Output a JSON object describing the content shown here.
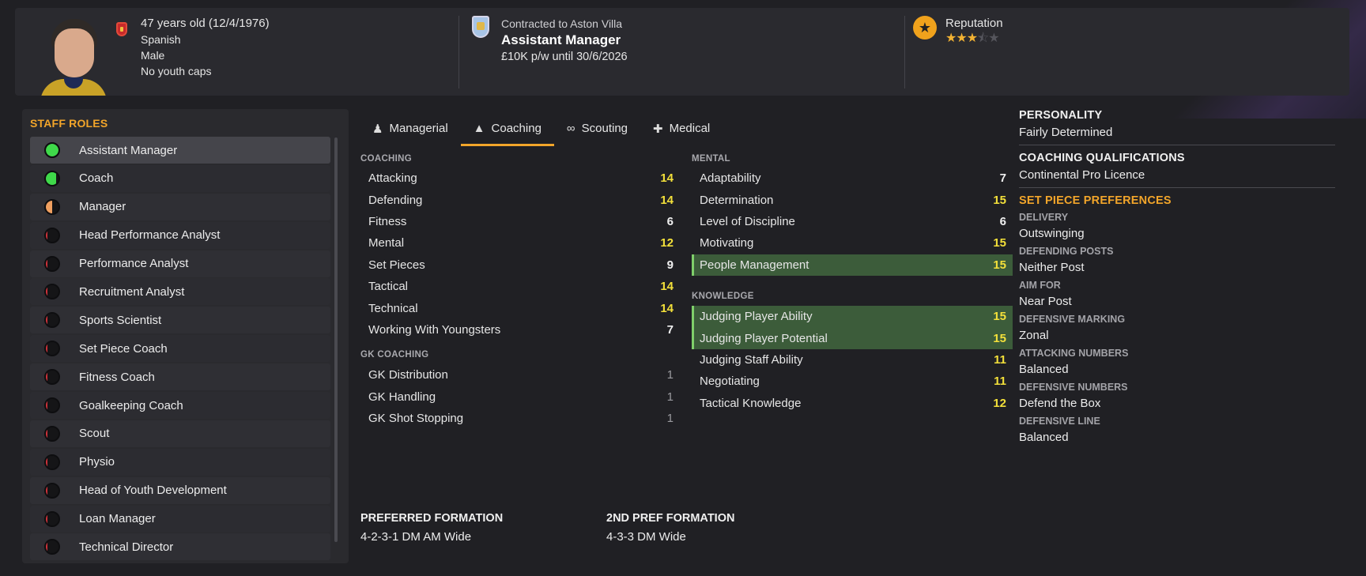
{
  "header": {
    "age": "47 years old (12/4/1976)",
    "nationality": "Spanish",
    "gender": "Male",
    "youth_caps": "No youth caps",
    "contract_club": "Contracted to Aston Villa",
    "contract_role": "Assistant Manager",
    "contract_wage": "£10K p/w until 30/6/2026",
    "reputation_label": "Reputation",
    "reputation_stars": 3.5
  },
  "staff_roles": {
    "title": "STAFF ROLES",
    "items": [
      {
        "label": "Assistant Manager",
        "fill": 1.0,
        "color": "#3fd94a",
        "selected": true
      },
      {
        "label": "Coach",
        "fill": 0.8,
        "color": "#3fd94a"
      },
      {
        "label": "Manager",
        "fill": 0.5,
        "color": "#f0a060"
      },
      {
        "label": "Head Performance Analyst",
        "fill": 0.12,
        "color": "#d0323a"
      },
      {
        "label": "Performance Analyst",
        "fill": 0.12,
        "color": "#d0323a"
      },
      {
        "label": "Recruitment Analyst",
        "fill": 0.12,
        "color": "#d0323a"
      },
      {
        "label": "Sports Scientist",
        "fill": 0.12,
        "color": "#d0323a"
      },
      {
        "label": "Set Piece Coach",
        "fill": 0.12,
        "color": "#d0323a"
      },
      {
        "label": "Fitness Coach",
        "fill": 0.12,
        "color": "#d0323a"
      },
      {
        "label": "Goalkeeping Coach",
        "fill": 0.12,
        "color": "#d0323a"
      },
      {
        "label": "Scout",
        "fill": 0.12,
        "color": "#d0323a"
      },
      {
        "label": "Physio",
        "fill": 0.12,
        "color": "#d0323a"
      },
      {
        "label": "Head of Youth Development",
        "fill": 0.12,
        "color": "#d0323a"
      },
      {
        "label": "Loan Manager",
        "fill": 0.12,
        "color": "#d0323a"
      },
      {
        "label": "Technical Director",
        "fill": 0.12,
        "color": "#d0323a"
      }
    ]
  },
  "tabs": [
    {
      "label": "Managerial",
      "icon": "managerial-icon"
    },
    {
      "label": "Coaching",
      "icon": "coaching-icon",
      "active": true
    },
    {
      "label": "Scouting",
      "icon": "binoculars-icon"
    },
    {
      "label": "Medical",
      "icon": "medical-kit-icon"
    }
  ],
  "coaching": {
    "title": "COACHING",
    "attrs": [
      {
        "label": "Attacking",
        "value": 14
      },
      {
        "label": "Defending",
        "value": 14
      },
      {
        "label": "Fitness",
        "value": 6
      },
      {
        "label": "Mental",
        "value": 12
      },
      {
        "label": "Set Pieces",
        "value": 9
      },
      {
        "label": "Tactical",
        "value": 14
      },
      {
        "label": "Technical",
        "value": 14
      },
      {
        "label": "Working With Youngsters",
        "value": 7
      }
    ]
  },
  "gk_coaching": {
    "title": "GK COACHING",
    "attrs": [
      {
        "label": "GK Distribution",
        "value": 1
      },
      {
        "label": "GK Handling",
        "value": 1
      },
      {
        "label": "GK Shot Stopping",
        "value": 1
      }
    ]
  },
  "mental": {
    "title": "MENTAL",
    "attrs": [
      {
        "label": "Adaptability",
        "value": 7
      },
      {
        "label": "Determination",
        "value": 15
      },
      {
        "label": "Level of Discipline",
        "value": 6
      },
      {
        "label": "Motivating",
        "value": 15
      },
      {
        "label": "People Management",
        "value": 15,
        "highlight": true
      }
    ]
  },
  "knowledge": {
    "title": "KNOWLEDGE",
    "attrs": [
      {
        "label": "Judging Player Ability",
        "value": 15,
        "highlight": true
      },
      {
        "label": "Judging Player Potential",
        "value": 15,
        "highlight": true
      },
      {
        "label": "Judging Staff Ability",
        "value": 11
      },
      {
        "label": "Negotiating",
        "value": 11
      },
      {
        "label": "Tactical Knowledge",
        "value": 12
      }
    ]
  },
  "right_panel": {
    "personality_title": "PERSONALITY",
    "personality": "Fairly Determined",
    "qualifications_title": "COACHING QUALIFICATIONS",
    "qualification": "Continental Pro Licence",
    "set_piece_title": "SET PIECE PREFERENCES",
    "prefs": [
      {
        "label": "DELIVERY",
        "value": "Outswinging"
      },
      {
        "label": "DEFENDING POSTS",
        "value": "Neither Post"
      },
      {
        "label": "AIM FOR",
        "value": "Near Post"
      },
      {
        "label": "DEFENSIVE MARKING",
        "value": "Zonal"
      },
      {
        "label": "ATTACKING NUMBERS",
        "value": "Balanced"
      },
      {
        "label": "DEFENSIVE NUMBERS",
        "value": "Defend the Box"
      },
      {
        "label": "DEFENSIVE LINE",
        "value": "Balanced"
      }
    ]
  },
  "formations": {
    "preferred_title": "PREFERRED FORMATION",
    "preferred": "4-2-3-1 DM AM Wide",
    "second_title": "2ND PREF FORMATION",
    "second": "4-3-3 DM Wide"
  },
  "colors": {
    "accent": "#f2a52a",
    "value_high": "#f3e03a",
    "highlight_row": "#3c5c3a"
  }
}
